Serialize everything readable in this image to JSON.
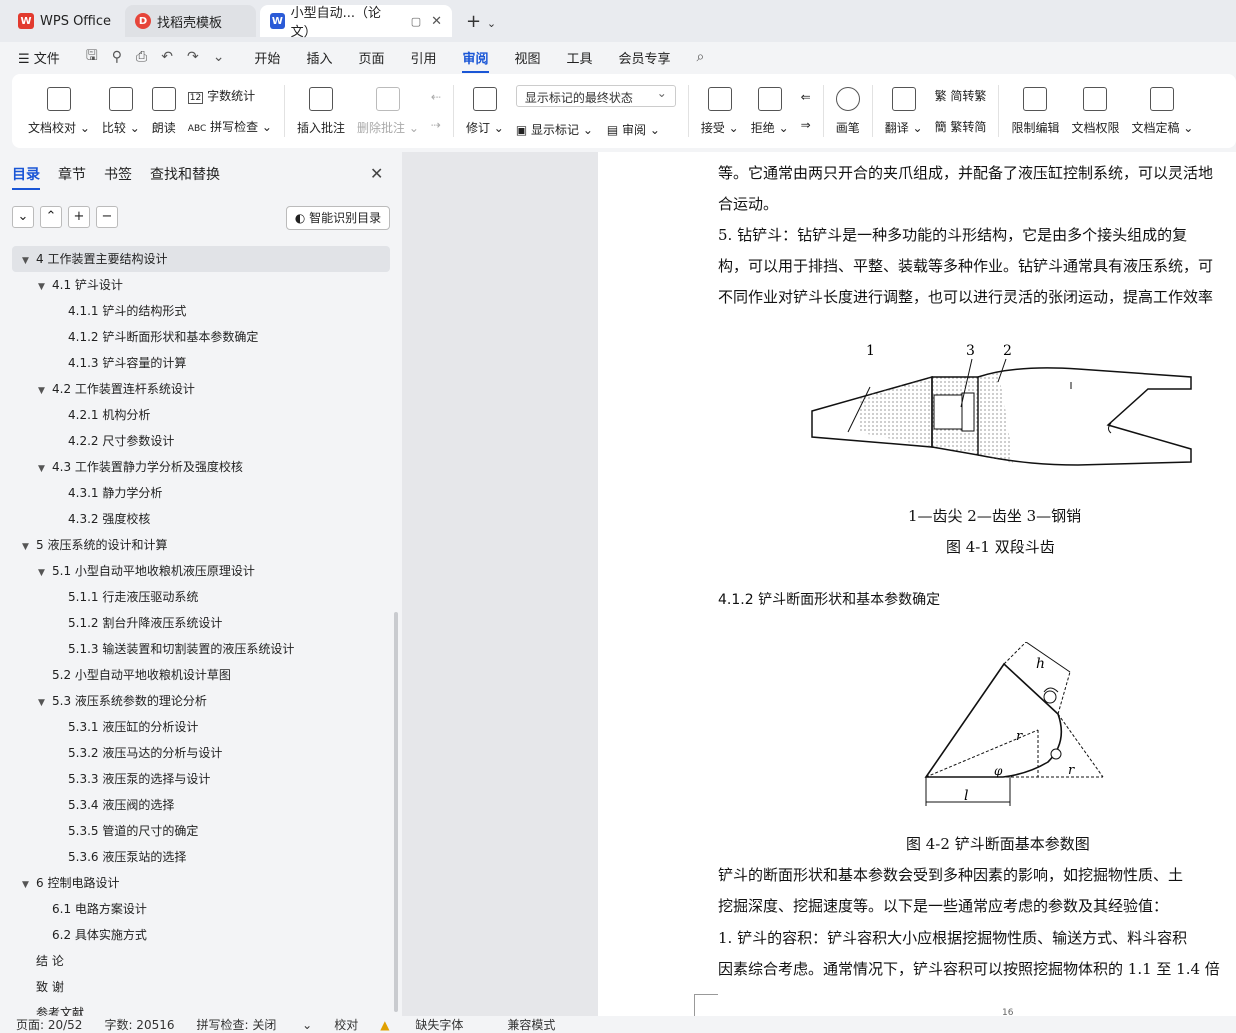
{
  "tabs": [
    {
      "label": "WPS Office",
      "icon": "wps-logo-icon"
    },
    {
      "label": "找稻壳模板",
      "icon": "docer-icon"
    },
    {
      "label": "小型自动...（论文）",
      "icon": "word-doc-icon"
    }
  ],
  "menu": {
    "file": "文件",
    "items": [
      "开始",
      "插入",
      "页面",
      "引用",
      "审阅",
      "视图",
      "工具",
      "会员专享"
    ],
    "active": "审阅"
  },
  "ribbon": {
    "doc_proofread": "文档校对",
    "compare": "比较",
    "read_aloud": "朗读",
    "word_count": "字数统计",
    "spell_check": "拼写检查",
    "insert_comment": "插入批注",
    "delete_comment": "删除批注",
    "revise": "修订",
    "markup_select": "显示标记的最终状态",
    "show_markup": "显示标记",
    "review": "审阅",
    "accept": "接受",
    "reject": "拒绝",
    "pen": "画笔",
    "translate": "翻译",
    "to_traditional": "简转繁",
    "to_simplified": "繁转简",
    "restrict_edit": "限制编辑",
    "permission": "文档权限",
    "finalize": "文档定稿"
  },
  "sidebar": {
    "tabs": [
      "目录",
      "章节",
      "书签",
      "查找和替换"
    ],
    "smart_toc": "智能识别目录",
    "toc": [
      {
        "t": "4  工作装置主要结构设计",
        "lvl": 0,
        "exp": true
      },
      {
        "t": "4.1  铲斗设计",
        "lvl": 1,
        "exp": true
      },
      {
        "t": "4.1.1  铲斗的结构形式",
        "lvl": 2
      },
      {
        "t": "4.1.2  铲斗断面形状和基本参数确定",
        "lvl": 2
      },
      {
        "t": "4.1.3  铲斗容量的计算",
        "lvl": 2
      },
      {
        "t": "4.2  工作装置连杆系统设计",
        "lvl": 1,
        "exp": true
      },
      {
        "t": "4.2.1  机构分析",
        "lvl": 2
      },
      {
        "t": "4.2.2  尺寸参数设计",
        "lvl": 2
      },
      {
        "t": "4.3  工作装置静力学分析及强度校核",
        "lvl": 1,
        "exp": true
      },
      {
        "t": "4.3.1  静力学分析",
        "lvl": 2
      },
      {
        "t": "4.3.2  强度校核",
        "lvl": 2
      },
      {
        "t": "5  液压系统的设计和计算",
        "lvl": 0,
        "exp": true
      },
      {
        "t": "5.1  小型自动平地收粮机液压原理设计",
        "lvl": 1,
        "exp": true
      },
      {
        "t": "5.1.1  行走液压驱动系统",
        "lvl": 2
      },
      {
        "t": "5.1.2  割台升降液压系统设计",
        "lvl": 2
      },
      {
        "t": "5.1.3 输送装置和切割装置的液压系统设计",
        "lvl": 2
      },
      {
        "t": "5.2  小型自动平地收粮机设计草图",
        "lvl": 1
      },
      {
        "t": "5.3  液压系统参数的理论分析",
        "lvl": 1,
        "exp": true
      },
      {
        "t": "5.3.1  液压缸的分析设计",
        "lvl": 2
      },
      {
        "t": "5.3.2  液压马达的分析与设计",
        "lvl": 2
      },
      {
        "t": "5.3.3  液压泵的选择与设计",
        "lvl": 2
      },
      {
        "t": "5.3.4  液压阀的选择",
        "lvl": 2
      },
      {
        "t": "5.3.5  管道的尺寸的确定",
        "lvl": 2
      },
      {
        "t": "5.3.6  液压泵站的选择",
        "lvl": 2
      },
      {
        "t": "6  控制电路设计",
        "lvl": 0,
        "exp": true
      },
      {
        "t": "6.1 电路方案设计",
        "lvl": 1
      },
      {
        "t": "6.2 具体实施方式",
        "lvl": 1
      },
      {
        "t": "结   论",
        "lvl": 0
      },
      {
        "t": "致   谢",
        "lvl": 0
      },
      {
        "t": "参考文献",
        "lvl": 0
      }
    ]
  },
  "doc": {
    "l1": "等。它通常由两只开合的夹爪组成，并配备了液压缸控制系统，可以灵活地",
    "l2": "合运动。",
    "l3": "    5. 钻铲斗：钻铲斗是一种多功能的斗形结构，它是由多个接头组成的复",
    "l4": "构，可以用于排挡、平整、装载等多种作业。钻铲斗通常具有液压系统，可",
    "l5": "不同作业对铲斗长度进行调整，也可以进行灵活的张闭运动，提高工作效率",
    "fig1_labels": [
      "1",
      "3",
      "2"
    ],
    "fig1_legend": "1—齿尖   2—齿坐   3—钢销",
    "fig1_caption": "图 4-1    双段斗齿",
    "section": "4.1.2  铲斗断面形状和基本参数确定",
    "fig2_labels": {
      "h": "h",
      "r1": "r",
      "phi": "φ",
      "r2": "r",
      "l": "l"
    },
    "fig2_caption": "图 4-2    铲斗断面基本参数图",
    "p1": "    铲斗的断面形状和基本参数会受到多种因素的影响，如挖掘物性质、土",
    "p2": "挖掘深度、挖掘速度等。以下是一些通常应考虑的参数及其经验值：",
    "p3": "    1. 铲斗的容积：铲斗容积大小应根据挖掘物性质、输送方式、料斗容积",
    "p4": "因素综合考虑。通常情况下，铲斗容积可以按照挖掘物体积的 1.1 至 1.4 倍",
    "page_num": "16"
  },
  "status": {
    "page": "页面: 20/52",
    "words": "字数: 20516",
    "spell": "拼写检查: 关闭",
    "proof": "校对",
    "missing_font": "缺失字体",
    "compat": "兼容模式"
  }
}
